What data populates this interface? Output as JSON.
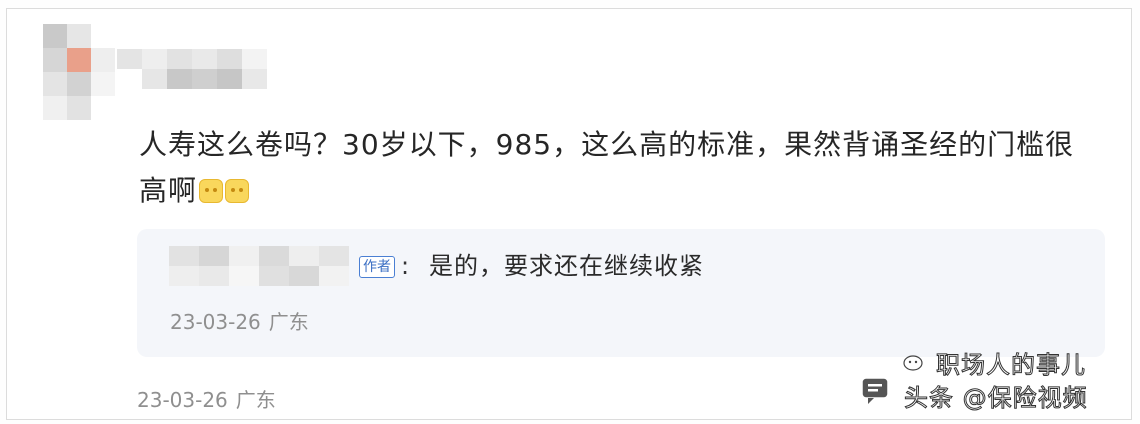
{
  "comment": {
    "text": "人寿这么卷吗？30岁以下，985，这么高的标准，果然背诵圣经的门槛很高啊",
    "emojis": [
      "emoji",
      "emoji"
    ],
    "date": "23-03-26",
    "location": "广东"
  },
  "reply": {
    "author_tag": "作者",
    "colon": ":",
    "text": "是的，要求还在继续收紧",
    "date": "23-03-26",
    "location": "广东"
  },
  "watermark": {
    "line1": "职场人的事儿",
    "line2": "头条 @保险视频"
  },
  "colors": {
    "author_tag": "#3b6fc4",
    "reply_background": "#f4f6fa",
    "meta_text": "#8f8f8f"
  }
}
